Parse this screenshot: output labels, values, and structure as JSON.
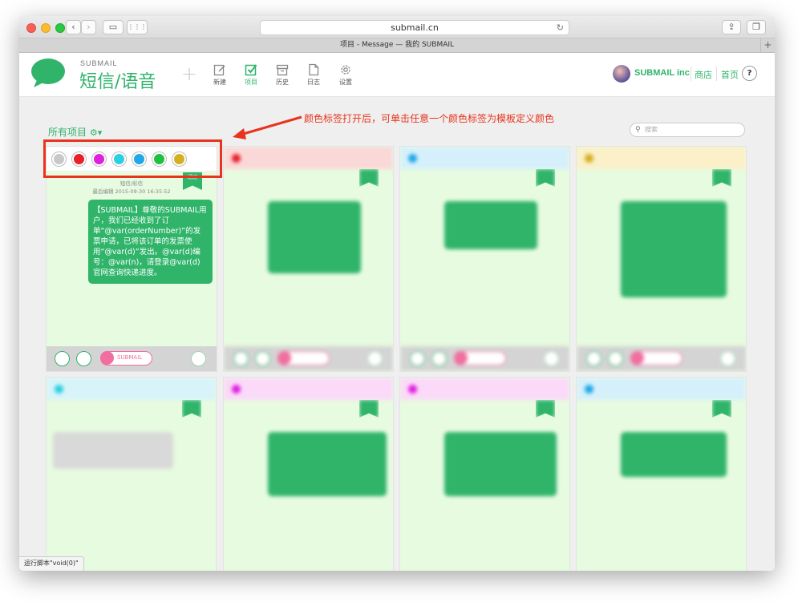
{
  "browser": {
    "url": "submail.cn",
    "tab_title": "项目 - Message — 我的 SUBMAIL",
    "status_text": "运行脚本\"void(0)\""
  },
  "header": {
    "brand_small": "SUBMAIL",
    "brand_big": "短信/语音",
    "nav": [
      {
        "label": "新建",
        "icon": "edit-icon"
      },
      {
        "label": "项目",
        "icon": "checkbox-icon",
        "active": true
      },
      {
        "label": "历史",
        "icon": "archive-icon"
      },
      {
        "label": "日志",
        "icon": "document-icon"
      },
      {
        "label": "设置",
        "icon": "gear-icon"
      }
    ],
    "account_name": "SUBMAIL inc",
    "store_link": "商店",
    "home_link": "首页",
    "help": "?"
  },
  "main": {
    "section_title": "所有项目",
    "search_placeholder": "搜索",
    "annotation": "颜色标签打开后，可单击任意一个颜色标签为模板定义颜色",
    "palette_colors": [
      "#c8c8c8",
      "#e8202a",
      "#e020e0",
      "#2ad0e0",
      "#20a8e8",
      "#20c040",
      "#d4b020"
    ],
    "colors": {
      "accent": "#2fb46a",
      "highlight": "#e8341c"
    },
    "first_card": {
      "type": "短信/彩信",
      "edited": "最后编辑 2015-09-30 16:35:52",
      "badge": "通过",
      "message": "【SUBMAIL】尊敬的SUBMAIL用户，我们已经收到了订单“@var(orderNumber)”的发票申请，已将该订单的发票使用“@var(d)”发出。@var(d)编号：@var(n)，请登录@var(d)官网查询快递进度。",
      "tag_label": "SUBMAIL"
    }
  }
}
